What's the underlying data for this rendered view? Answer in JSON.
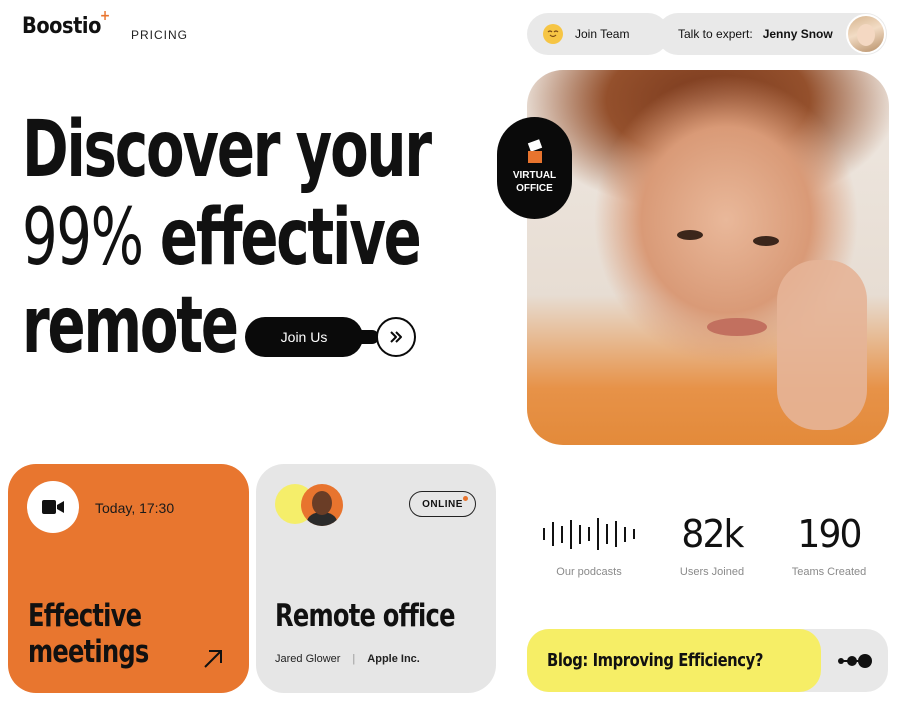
{
  "header": {
    "logo": "Boostio",
    "logo_mark": "+",
    "nav_pricing": "PRICING",
    "join_team": "Join Team",
    "talk_expert_label": "Talk to expert:",
    "expert_name": "Jenny Snow",
    "emoji_icon": "smiling-face-icon"
  },
  "hero": {
    "line1": "Discover your",
    "line2_pct": "99%",
    "line2_rest": "effective",
    "line3": "remote",
    "join_button": "Join Us"
  },
  "badge": {
    "line1": "VIRTUAL",
    "line2": "OFFICE"
  },
  "card_meetings": {
    "time": "Today, 17:30",
    "title_line1": "Effective",
    "title_line2": "meetings"
  },
  "card_office": {
    "status": "ONLINE",
    "title": "Remote office",
    "person": "Jared Glower",
    "separator": "|",
    "company": "Apple Inc."
  },
  "stats": {
    "podcasts_label": "Our podcasts",
    "users_value": "82k",
    "users_label": "Users Joined",
    "teams_value": "190",
    "teams_label": "Teams Created",
    "waveform_levels": [
      0.35,
      0.7,
      0.5,
      0.85,
      0.55,
      0.4,
      0.95,
      0.6,
      0.75,
      0.45,
      0.3
    ]
  },
  "blog": {
    "title": "Blog: Improving Efficiency?"
  },
  "colors": {
    "accent_orange": "#E8762F",
    "accent_yellow": "#F6EE66",
    "dark": "#0a0a0a",
    "light_gray": "#e6e6e6"
  }
}
